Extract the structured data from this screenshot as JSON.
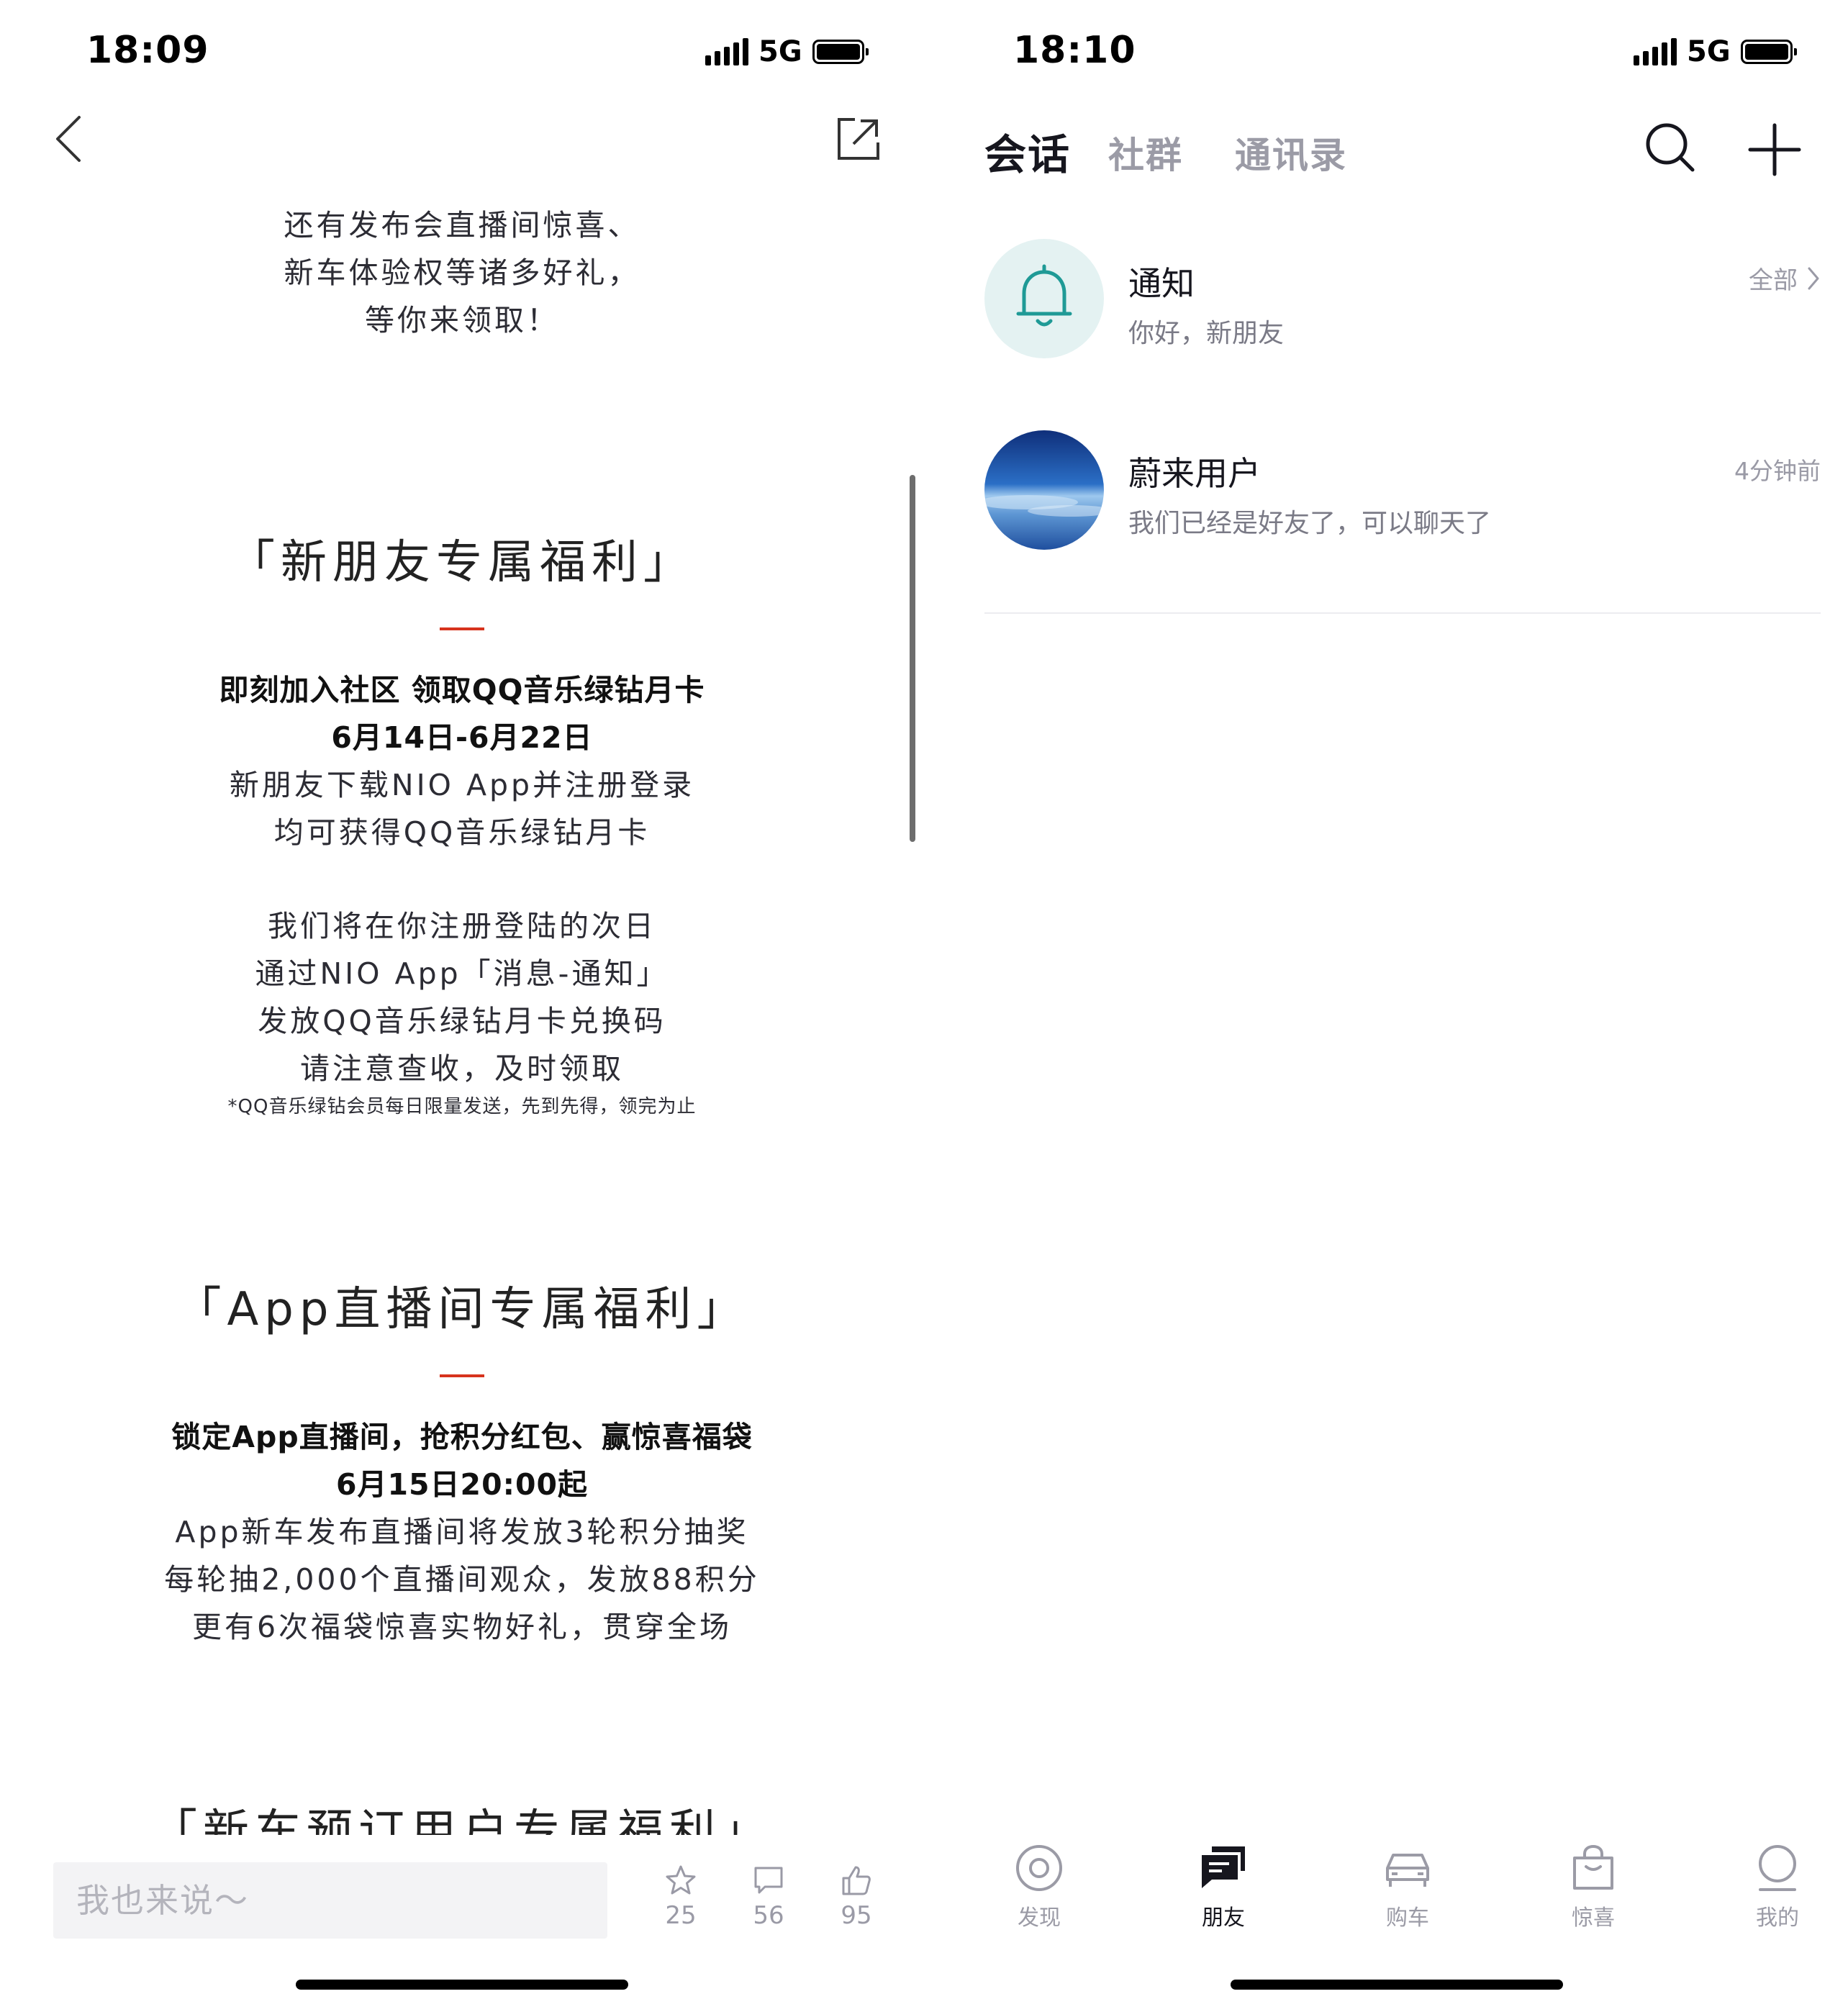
{
  "left": {
    "status_bar": {
      "time": "18:09",
      "network": "5G"
    },
    "header": {
      "back_icon": "chevron-left-icon",
      "share_icon": "share-external-icon"
    },
    "article": {
      "intro": [
        "还有发布会直播间惊喜、",
        "新车体验权等诸多好礼，",
        "等你来领取！"
      ],
      "section1": {
        "title": "「新朋友专属福利」",
        "bold_lines": [
          "即刻加入社区 领取QQ音乐绿钻月卡",
          "6月14日-6月22日"
        ],
        "lines": [
          "新朋友下载NIO App并注册登录",
          "均可获得QQ音乐绿钻月卡"
        ],
        "lines2": [
          "我们将在你注册登陆的次日",
          "通过NIO App「消息-通知」",
          "发放QQ音乐绿钻月卡兑换码",
          "请注意查收，及时领取"
        ],
        "note": "*QQ音乐绿钻会员每日限量发送，先到先得，领完为止"
      },
      "section2": {
        "title": "「App直播间专属福利」",
        "bold_lines": [
          "锁定App直播间，抢积分红包、赢惊喜福袋",
          "6月15日20:00起"
        ],
        "lines": [
          "App新车发布直播间将发放3轮积分抽奖",
          "每轮抽2,000个直播间观众，发放88积分",
          "更有6次福袋惊喜实物好礼，贯穿全场"
        ]
      },
      "section3": {
        "title": "「新车预订用户专属福利」"
      }
    },
    "bottom_bar": {
      "input_placeholder": "我也来说～",
      "favorite": {
        "icon": "star-icon",
        "count": "25"
      },
      "comment": {
        "icon": "comment-icon",
        "count": "56"
      },
      "like": {
        "icon": "thumbs-up-icon",
        "count": "95"
      }
    }
  },
  "right": {
    "status_bar": {
      "time": "18:10",
      "network": "5G"
    },
    "tabs": [
      {
        "label": "会话",
        "active": true
      },
      {
        "label": "社群",
        "active": false
      },
      {
        "label": "通讯录",
        "active": false
      }
    ],
    "header_icons": {
      "search": "search-icon",
      "add": "plus-icon"
    },
    "conversations": [
      {
        "name": "通知",
        "message": "你好，新朋友",
        "meta": "全部",
        "avatar_icon": "bell-icon"
      },
      {
        "name": "蔚来用户",
        "message": "我们已经是好友了，可以聊天了",
        "meta": "4分钟前",
        "avatar_icon": "sky-avatar"
      }
    ],
    "bottom_nav": [
      {
        "label": "发现",
        "icon": "target-icon",
        "active": false
      },
      {
        "label": "朋友",
        "icon": "chat-bubbles-icon",
        "active": true
      },
      {
        "label": "购车",
        "icon": "car-icon",
        "active": false
      },
      {
        "label": "惊喜",
        "icon": "shopping-bag-icon",
        "active": false
      },
      {
        "label": "我的",
        "icon": "profile-icon",
        "active": false
      }
    ],
    "colors": {
      "accent_red": "#d7331d",
      "bell_bg": "#e4f2f2",
      "bell_stroke": "#1f9a96"
    }
  }
}
